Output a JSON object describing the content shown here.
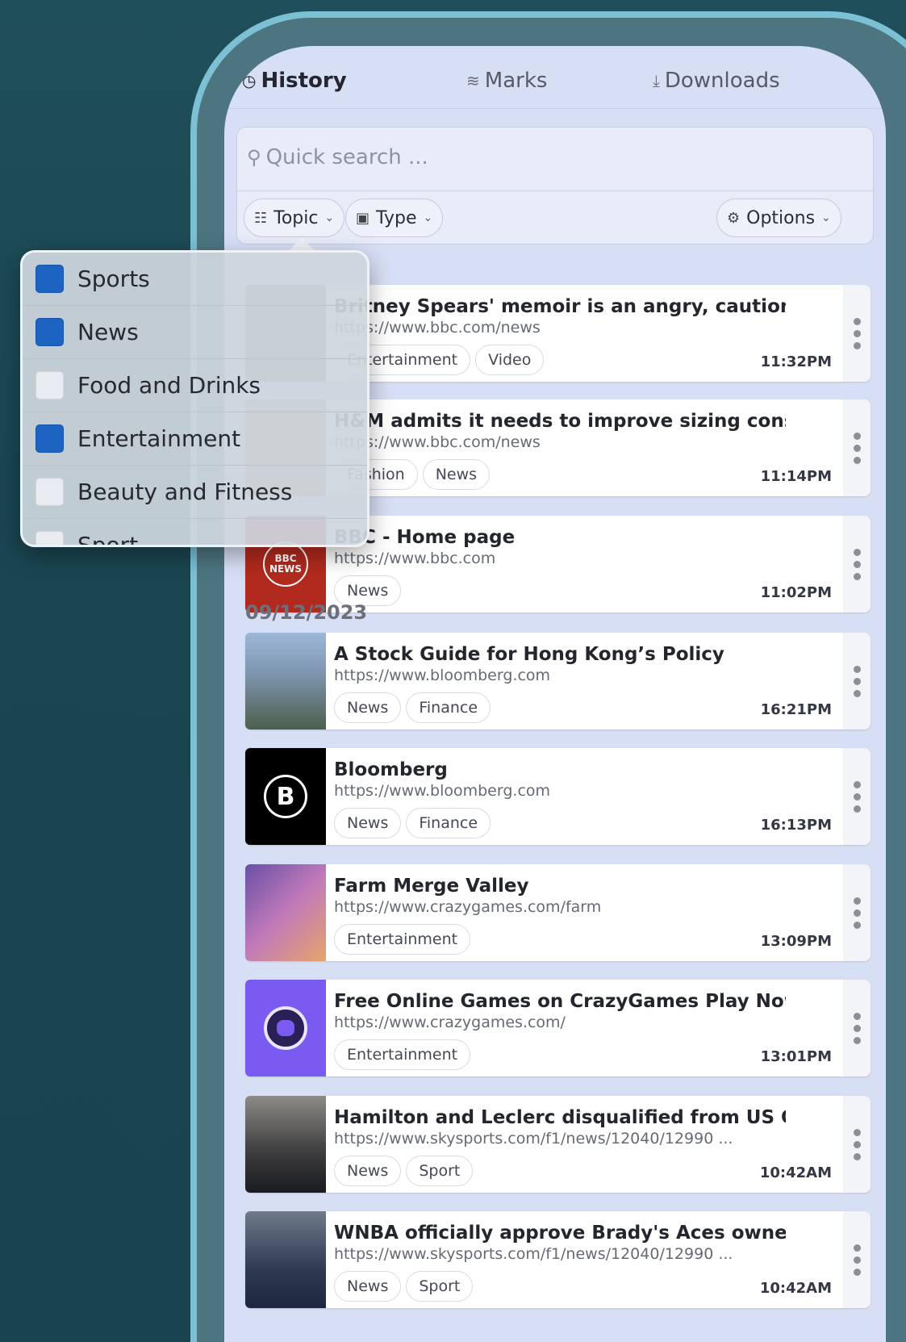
{
  "tabs": [
    {
      "label": "History",
      "icon": "history-icon",
      "active": true
    },
    {
      "label": "Marks",
      "icon": "layers-icon",
      "active": false
    },
    {
      "label": "Downloads",
      "icon": "download-icon",
      "active": false
    }
  ],
  "search": {
    "placeholder": "Quick search ...",
    "icon": "search-icon"
  },
  "filters": {
    "topic_label": "Topic",
    "type_label": "Type",
    "options_label": "Options"
  },
  "topic_dropdown": {
    "items": [
      {
        "label": "Sports",
        "checked": true
      },
      {
        "label": "News",
        "checked": true
      },
      {
        "label": "Food and Drinks",
        "checked": false
      },
      {
        "label": "Entertainment",
        "checked": true
      },
      {
        "label": "Beauty and Fitness",
        "checked": false
      },
      {
        "label": "Sport",
        "checked": false
      }
    ],
    "check_color": "#1c63c2"
  },
  "history_today": [
    {
      "title": "Britney Spears' memoir is an angry, cautionary",
      "url": "https://www.bbc.com/news",
      "tags": [
        "Entertainment",
        "Video"
      ],
      "time": "11:32PM"
    },
    {
      "title": "H&M admits it needs to improve sizing consi ...",
      "url": "https://www.bbc.com/news",
      "tags": [
        "Fashion",
        "News"
      ],
      "time": "11:14PM"
    },
    {
      "title": "BBC - Home page",
      "url": "https://www.bbc.com",
      "tags": [
        "News"
      ],
      "time": "11:02PM",
      "thumb_text": "BBC NEWS"
    }
  ],
  "date_group": "09/12/2023",
  "history_dated": [
    {
      "title": "A Stock Guide for Hong Kong’s Policy",
      "url": "https://www.bloomberg.com",
      "tags": [
        "News",
        "Finance"
      ],
      "time": "16:21PM"
    },
    {
      "title": "Bloomberg",
      "url": "https://www.bloomberg.com",
      "tags": [
        "News",
        "Finance"
      ],
      "time": "16:13PM",
      "thumb_text": "B"
    },
    {
      "title": "Farm Merge Valley",
      "url": "https://www.crazygames.com/farm",
      "tags": [
        "Entertainment"
      ],
      "time": "13:09PM"
    },
    {
      "title": "Free Online Games on CrazyGames Play Now!",
      "url": "https://www.crazygames.com/",
      "tags": [
        "Entertainment"
      ],
      "time": "13:01PM"
    },
    {
      "title": "Hamilton and Leclerc disqualified from US GP",
      "url": "https://www.skysports.com/f1/news/12040/12990 ...",
      "tags": [
        "News",
        "Sport"
      ],
      "time": "10:42AM"
    },
    {
      "title": "WNBA officially approve Brady's Aces owner ...",
      "url": "https://www.skysports.com/f1/news/12040/12990 ...",
      "tags": [
        "News",
        "Sport"
      ],
      "time": "10:42AM"
    }
  ],
  "colors": {
    "screen_bg": "#d7dff5",
    "page_bg": "#1a4651",
    "device_frame": "#7bc0d3"
  }
}
